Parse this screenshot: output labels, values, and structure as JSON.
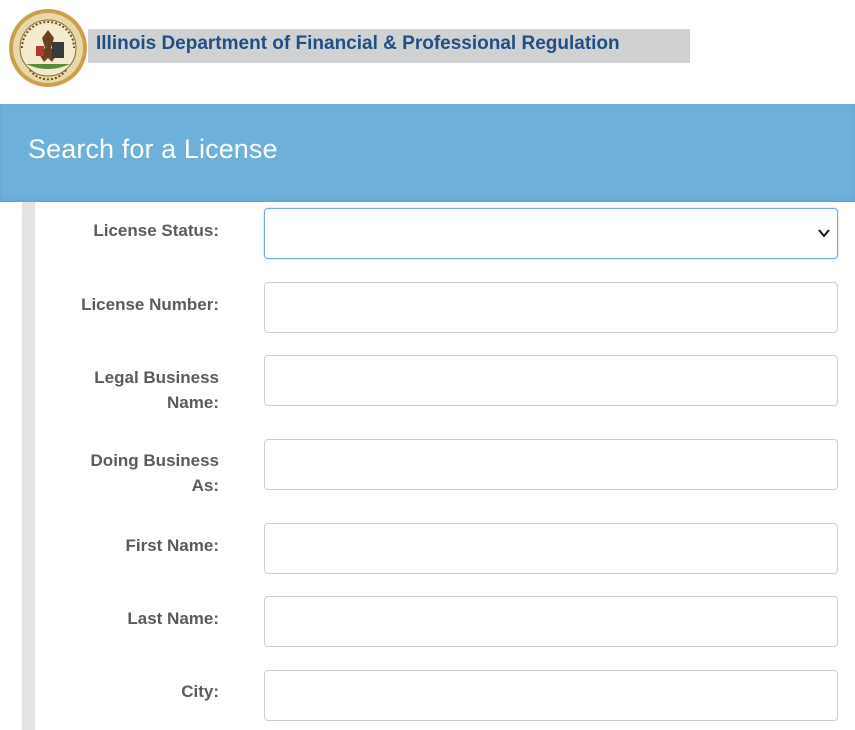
{
  "header": {
    "agency_name": "Illinois Department of Financial & Professional Regulation",
    "seal_icon": "illinois-state-seal-icon"
  },
  "page": {
    "title": "Search for a License"
  },
  "colors": {
    "title_bar": "#6db0da",
    "agency_text": "#1f4f86",
    "label_text": "#5b5b5b"
  },
  "form": {
    "license_status": {
      "label": "License Status:",
      "value": ""
    },
    "license_number": {
      "label": "License Number:",
      "value": ""
    },
    "legal_business_name": {
      "label_line1": "Legal Business",
      "label_line2": "Name:",
      "value": ""
    },
    "doing_business_as": {
      "label_line1": "Doing Business",
      "label_line2": "As:",
      "value": ""
    },
    "first_name": {
      "label": "First Name:",
      "value": ""
    },
    "last_name": {
      "label": "Last Name:",
      "value": ""
    },
    "city": {
      "label": "City:",
      "value": ""
    }
  }
}
